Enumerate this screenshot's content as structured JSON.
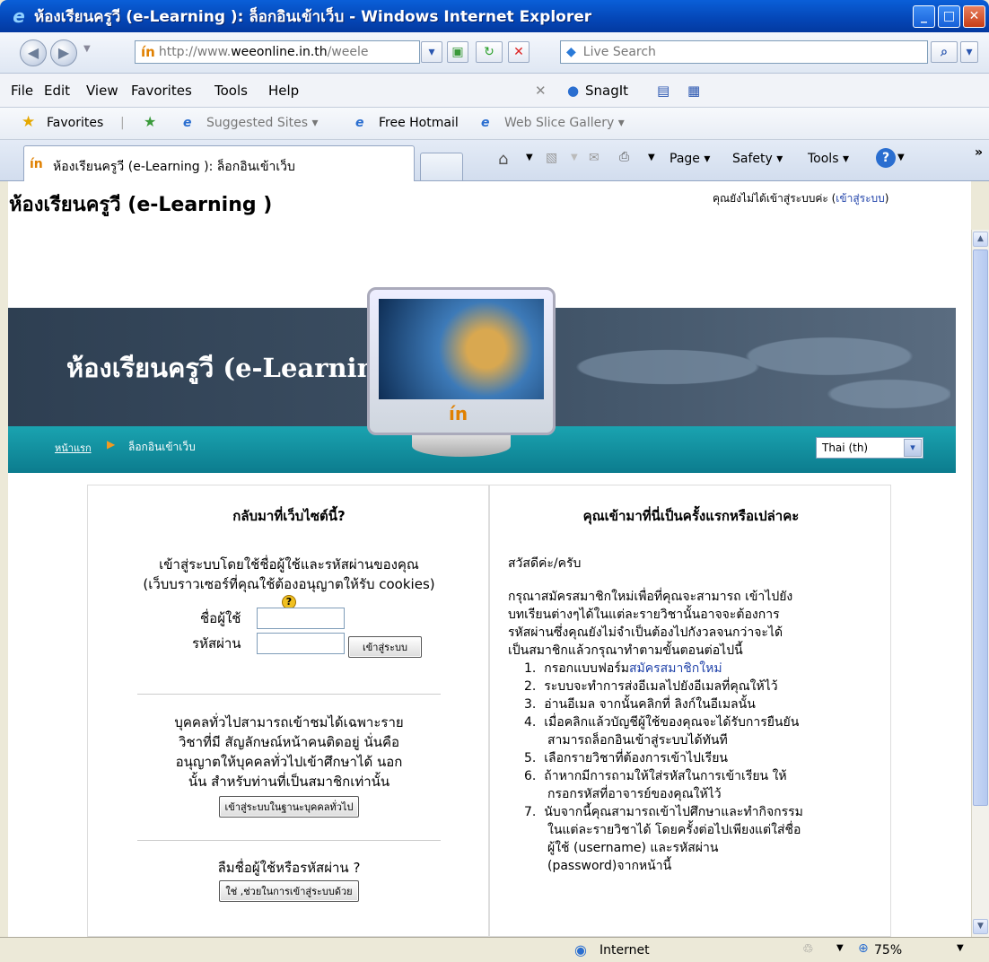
{
  "window": {
    "title": "ห้องเรียนครูวี (e-Learning ): ล็อกอินเข้าเว็บ - Windows Internet Explorer"
  },
  "address": {
    "url_prefix": "http://www.",
    "url_domain": "weeonline.in.th",
    "url_suffix": "/weele",
    "search_placeholder": "Live Search"
  },
  "menu": [
    "File",
    "Edit",
    "View",
    "Favorites",
    "Tools",
    "Help"
  ],
  "snagit": "SnagIt",
  "favorites": {
    "label": "Favorites",
    "suggested": "Suggested Sites ▾",
    "hotmail": "Free Hotmail",
    "webslice": "Web Slice Gallery ▾"
  },
  "tab": {
    "title": "ห้องเรียนครูวี (e-Learning ): ล็อกอินเข้าเว็บ"
  },
  "commandbar": {
    "page": "Page ▾",
    "safety": "Safety ▾",
    "tools": "Tools ▾",
    "more": "»"
  },
  "site": {
    "header_title": "ห้องเรียนครูวี (e-Learning )",
    "login_status": "คุณยังไม่ได้เข้าสู่ระบบค่ะ (",
    "login_link": "เข้าสู่ระบบ",
    "login_status_end": ")",
    "banner_title": "ห้องเรียนครูวี (e-Learning )",
    "breadcrumb_home": "หน้าแรก",
    "breadcrumb_current": "ล็อกอินเข้าเว็บ",
    "language": "Thai (th)"
  },
  "left_panel": {
    "heading": "กลับมาที่เว็บไซต์นี้?",
    "intro1": "เข้าสู่ระบบโดยใช้ชื่อผู้ใช้และรหัสผ่านของคุณ",
    "intro2": "(เว็บบราวเซอร์ที่คุณใช้ต้องอนุญาตให้รับ cookies)",
    "username_label": "ชื่อผู้ใช้",
    "password_label": "รหัสผ่าน",
    "login_button": "เข้าสู่ระบบ",
    "guest_text1": "บุคคลทั่วไปสามารถเข้าชมได้เฉพาะราย",
    "guest_text2": "วิชาที่มี สัญลักษณ์หน้าคนติดอยู่ นั่นคือ",
    "guest_text3": "อนุญาตให้บุคคลทั่วไปเข้าศึกษาได้ นอก",
    "guest_text4": "นั้น สำหรับท่านที่เป็นสมาชิกเท่านั้น",
    "guest_button": "เข้าสู่ระบบในฐานะบุคคลทั่วไป",
    "forgot_text": "ลืมชื่อผู้ใช้หรือรหัสผ่าน ?",
    "forgot_button": "ใช่ ,ช่วยในการเข้าสู่ระบบด้วย"
  },
  "right_panel": {
    "heading": "คุณเข้ามาที่นี่เป็นครั้งแรกหรือเปล่าคะ",
    "greeting": "สวัสดีค่ะ/ครับ",
    "para1": "กรุณาสมัครสมาชิกใหม่เพื่อที่คุณจะสามารถ เข้าไปยัง",
    "para2": "บทเรียนต่างๆได้ในแต่ละรายวิชานั้นอาจจะต้องการ",
    "para3": "รหัสผ่านซึ่งคุณยังไม่จำเป็นต้องไปกังวลจนกว่าจะได้",
    "para4": "เป็นสมาชิกแล้วกรุณาทำตามขั้นตอนต่อไปนี้",
    "step1a": "กรอกแบบฟอร์ม",
    "step1_link": "สมัครสมาชิกใหม่",
    "step2": "ระบบจะทำการส่งอีเมลไปยังอีเมลที่คุณให้ไว้",
    "step3": "อ่านอีเมล จากนั้นคลิกที่ ลิงก์ในอีเมลนั้น",
    "step4a": "เมื่อคลิกแล้วบัญชีผู้ใช้ของคุณจะได้รับการยืนยัน",
    "step4b": "สามารถล็อกอินเข้าสู่ระบบได้ทันที",
    "step5": "เลือกรายวิชาที่ต้องการเข้าไปเรียน",
    "step6a": "ถ้าหากมีการถามให้ใส่รหัสในการเข้าเรียน ให้",
    "step6b": "กรอกรหัสที่อาจารย์ของคุณให้ไว้",
    "step7a": "นับจากนี้คุณสามารถเข้าไปศึกษาและทำกิจกรรม",
    "step7b": "ในแต่ละรายวิชาได้ โดยครั้งต่อไปเพียงแต่ใส่ชื่อ",
    "step7c": "ผู้ใช้ (username) และรหัสผ่าน",
    "step7d": "(password)จากหน้านี้"
  },
  "status": {
    "zone": "Internet",
    "zoom": "75%"
  }
}
